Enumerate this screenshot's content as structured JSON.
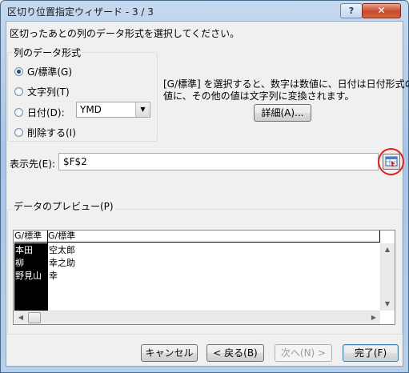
{
  "window": {
    "title": "区切り位置指定ウィザード - 3 / 3",
    "help_label": "?",
    "close_label": "✕"
  },
  "instruction": "区切ったあとの列のデータ形式を選択してください。",
  "format_group": {
    "title": "列のデータ形式",
    "options": [
      {
        "label": "G/標準(G)",
        "checked": true
      },
      {
        "label": "文字列(T)",
        "checked": false
      },
      {
        "label": "日付(D):",
        "checked": false
      },
      {
        "label": "削除する(I)",
        "checked": false
      }
    ],
    "date_format": "YMD"
  },
  "description": {
    "line1": "[G/標準] を選択すると、数字は数値に、日付は日付形式の",
    "line2": "値に、その他の値は文字列に変換されます。"
  },
  "detail_button": "詳細(A)...",
  "destination": {
    "label": "表示先(E):",
    "value": "$F$2"
  },
  "preview": {
    "title": "データのプレビュー(P)",
    "headers": [
      "G/標準",
      "G/標準"
    ],
    "rows": [
      [
        "本田",
        "空太郎"
      ],
      [
        "柳",
        "幸之助"
      ],
      [
        "野見山",
        "幸"
      ]
    ]
  },
  "buttons": {
    "cancel": "キャンセル",
    "back": "< 戻る(B)",
    "next": "次へ(N) >",
    "finish": "完了(F)"
  },
  "colors": {
    "highlight_circle": "#e02020",
    "close_button": "#c9492c"
  }
}
